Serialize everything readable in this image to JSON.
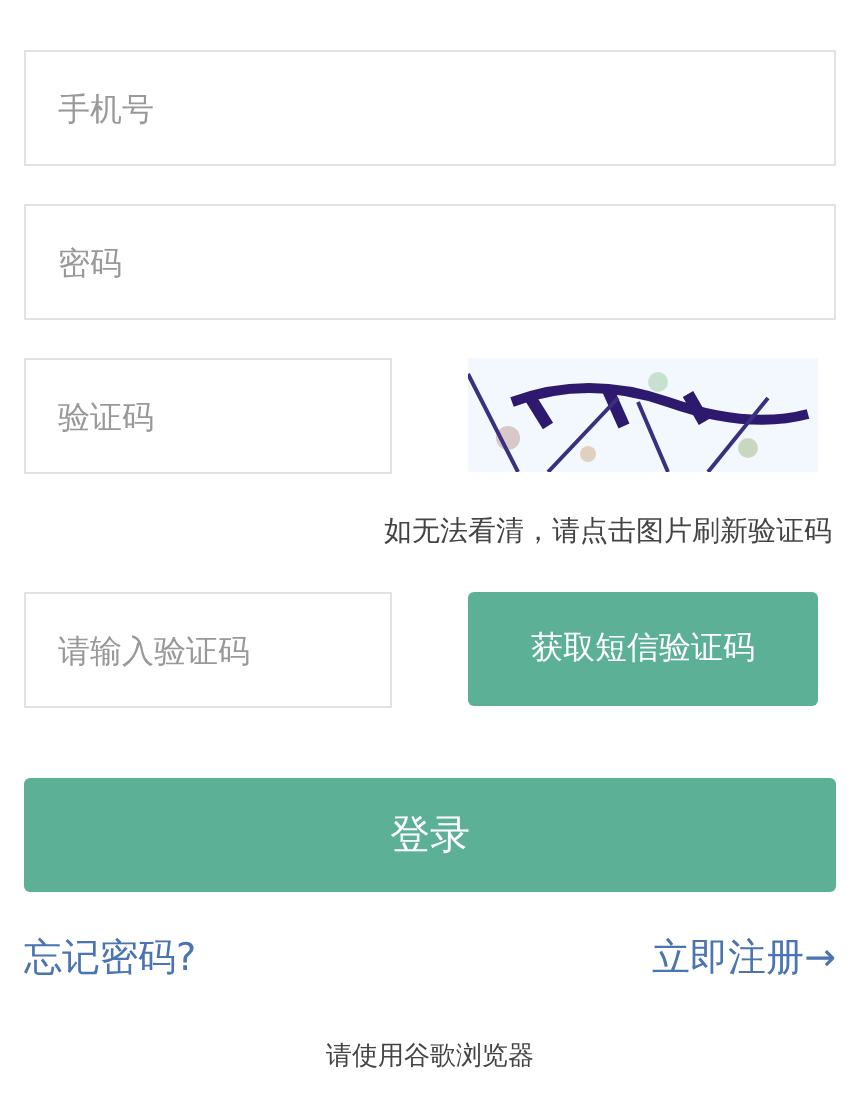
{
  "phone_field": {
    "placeholder": "手机号"
  },
  "password_field": {
    "placeholder": "密码"
  },
  "captcha_field": {
    "placeholder": "验证码"
  },
  "captcha_hint": "如无法看清，请点击图片刷新验证码",
  "sms_field": {
    "placeholder": "请输入验证码"
  },
  "sms_button": "获取短信验证码",
  "login_button": "登录",
  "forgot_link": "忘记密码?",
  "register_link": "立即注册→",
  "footer_note": "请使用谷歌浏览器"
}
